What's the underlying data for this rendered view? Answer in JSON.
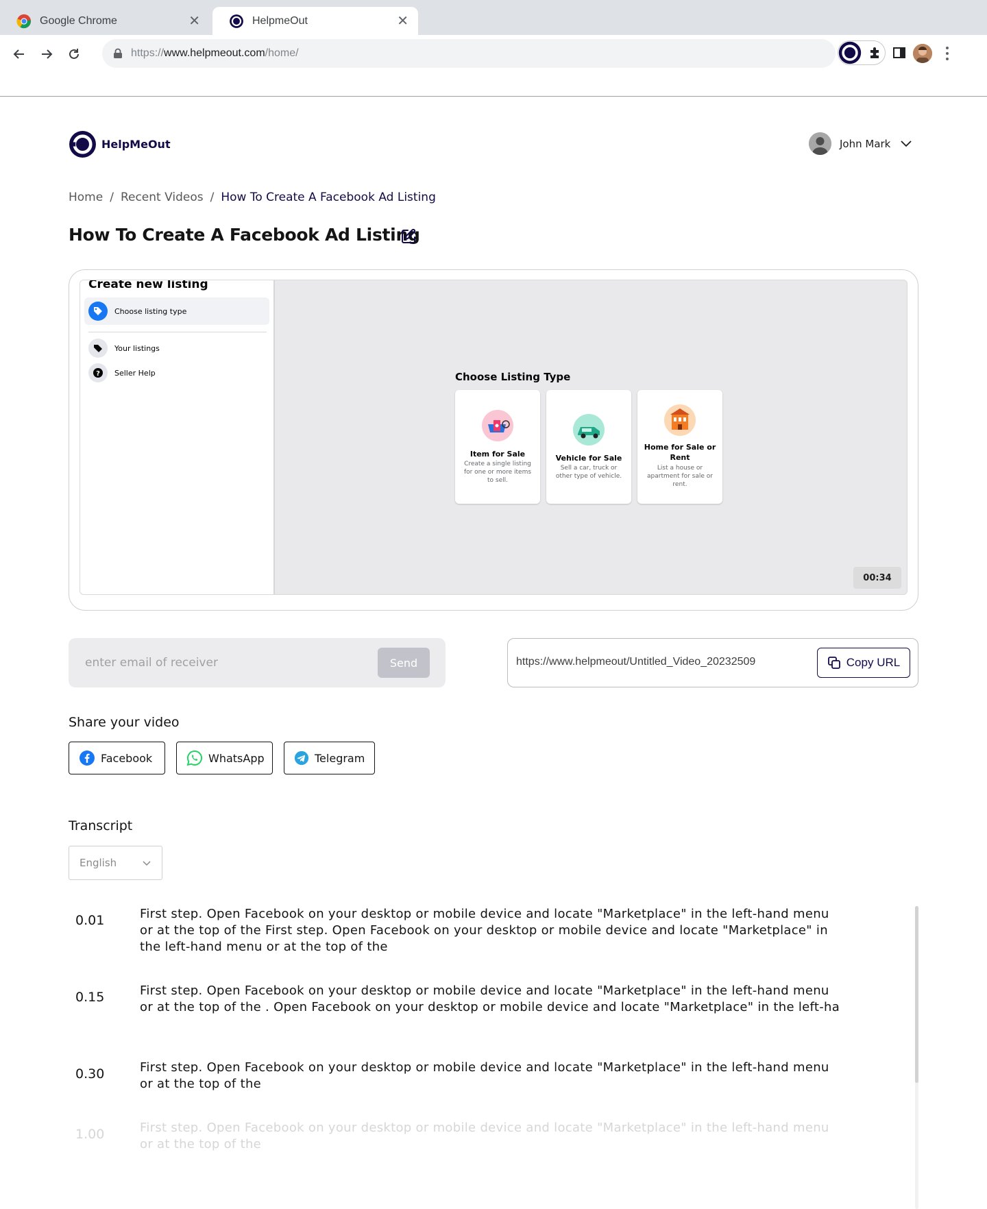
{
  "browser": {
    "tabs": [
      {
        "title": "Google Chrome",
        "close": "✕"
      },
      {
        "title": "HelpmeOut",
        "close": "✕"
      }
    ],
    "url": {
      "scheme": "https://",
      "host": "www.helpmeout.com",
      "path": "/home/"
    }
  },
  "header": {
    "brand": "HelpMeOut",
    "user_name": "John Mark"
  },
  "breadcrumb": {
    "home": "Home",
    "sep1": "/",
    "recent": "Recent Videos",
    "sep2": "/",
    "current": "How To Create A Facebook Ad Listing"
  },
  "page_title": "How To Create A Facebook Ad Listing",
  "video": {
    "sidebar_title": "Create new listing",
    "sidebar_items": [
      {
        "label": "Choose listing type",
        "icon": "tag-icon"
      },
      {
        "label": "Your listings",
        "icon": "tags-icon"
      },
      {
        "label": "Seller Help",
        "icon": "question-icon"
      }
    ],
    "panel_title": "Choose Listing Type",
    "cards": [
      {
        "title": "Item for Sale",
        "desc": "Create a single listing for one or more items to sell.",
        "icon": "item-icon"
      },
      {
        "title": "Vehicle for Sale",
        "desc": "Sell a car, truck or other type of vehicle.",
        "icon": "car-icon"
      },
      {
        "title": "Home for Sale or Rent",
        "desc": "List a house or apartment for sale or rent.",
        "icon": "house-icon"
      }
    ],
    "timestamp": "00:34"
  },
  "email": {
    "placeholder": "enter email of receiver",
    "send_label": "Send"
  },
  "share_url": {
    "url": "https://www.helpmeout/Untitled_Video_20232509",
    "copy_label": "Copy URL"
  },
  "share": {
    "title": "Share your video",
    "buttons": [
      {
        "label": "Facebook",
        "icon": "facebook-icon"
      },
      {
        "label": "WhatsApp",
        "icon": "whatsapp-icon"
      },
      {
        "label": "Telegram",
        "icon": "telegram-icon"
      }
    ]
  },
  "transcript": {
    "title": "Transcript",
    "language": "English",
    "entries": [
      {
        "time": "0.01",
        "text": "First step. Open Facebook on your desktop or mobile device and locate \"Marketplace\" in the left-hand menu or at the top of the First step. Open Facebook on your desktop or mobile device and locate \"Marketplace\" in the left-hand menu or at the top of the"
      },
      {
        "time": "0.15",
        "text": "First step. Open Facebook on your desktop or mobile device and locate \"Marketplace\" in the left-hand menu or at the top of the . Open Facebook on your desktop or mobile device and locate \"Marketplace\" in the left-ha"
      },
      {
        "time": "0.30",
        "text": "First step. Open Facebook on your desktop or mobile device and locate \"Marketplace\" in the left-hand menu or at the top of the"
      },
      {
        "time": "1.00",
        "text": "First step. Open Facebook on your desktop or mobile device and locate \"Marketplace\" in the left-hand menu or at the top of the"
      }
    ]
  },
  "colors": {
    "brand": "#120b48",
    "muted_bg": "#ececef",
    "send_disabled": "#c2c2ca",
    "facebook": "#1877f2",
    "whatsapp": "#25d366",
    "telegram": "#2aa3df"
  }
}
